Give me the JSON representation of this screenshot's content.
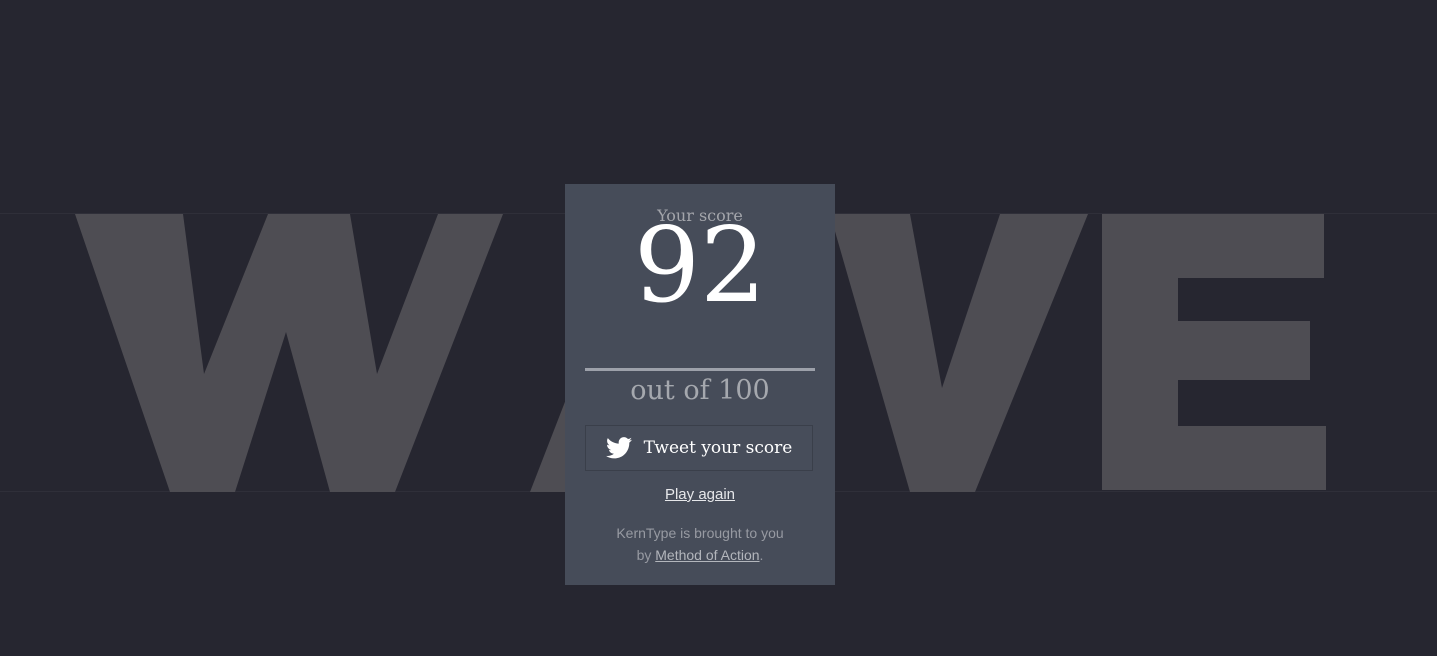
{
  "background_word": "WAVE",
  "colors": {
    "page_background": "#262630",
    "word": "#4e4d53",
    "card": "#464c59",
    "score": "#ffffff",
    "muted": "#a3a5ab"
  },
  "result": {
    "label": "Your score",
    "score": "92",
    "out_of": "out of 100"
  },
  "actions": {
    "tweet_icon": "twitter-bird-icon",
    "tweet_label": "Tweet your score",
    "play_again_label": "Play again"
  },
  "credit": {
    "line1": "KernType is brought to you",
    "by": "by ",
    "link": "Method of Action",
    "end": "."
  }
}
